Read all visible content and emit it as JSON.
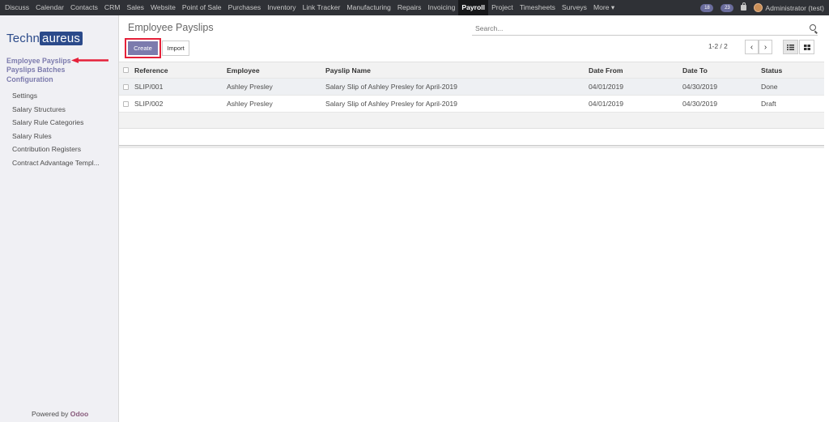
{
  "menu": {
    "items": [
      "Discuss",
      "Calendar",
      "Contacts",
      "CRM",
      "Sales",
      "Website",
      "Point of Sale",
      "Purchases",
      "Inventory",
      "Link Tracker",
      "Manufacturing",
      "Repairs",
      "Invoicing",
      "Payroll",
      "Project",
      "Timesheets",
      "Surveys",
      "More ▾"
    ],
    "active": "Payroll",
    "badges": [
      "18",
      "23"
    ],
    "user": "Administrator (test)"
  },
  "sidebar": {
    "logo_part1": "Techn",
    "logo_part2": "aureus",
    "top_items": [
      "Employee Payslips",
      "Payslips Batches"
    ],
    "section": "Configuration",
    "sub_items": [
      "Settings",
      "Salary Structures",
      "Salary Rule Categories",
      "Salary Rules",
      "Contribution Registers",
      "Contract Advantage Templ..."
    ],
    "powered_prefix": "Powered by ",
    "powered_brand": "Odoo"
  },
  "control": {
    "title": "Employee Payslips",
    "search_placeholder": "Search...",
    "create_label": "Create",
    "import_label": "Import",
    "pager": "1-2 / 2",
    "prev": "‹",
    "next": "›"
  },
  "table": {
    "columns": [
      "Reference",
      "Employee",
      "Payslip Name",
      "Date From",
      "Date To",
      "Status"
    ],
    "rows": [
      [
        "SLIP/001",
        "Ashley Presley",
        "Salary Slip of Ashley Presley for April-2019",
        "04/01/2019",
        "04/30/2019",
        "Done"
      ],
      [
        "SLIP/002",
        "Ashley Presley",
        "Salary Slip of Ashley Presley for April-2019",
        "04/01/2019",
        "04/30/2019",
        "Draft"
      ]
    ]
  },
  "colors": {
    "topbar": "#2f3136",
    "accent": "#7c7bad",
    "highlight": "#e5213a"
  }
}
